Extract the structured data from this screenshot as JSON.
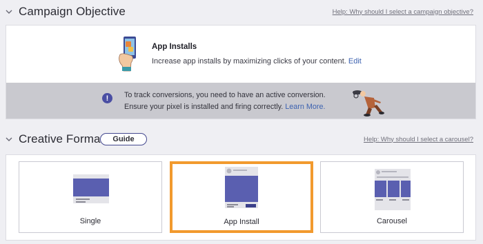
{
  "campaign_objective": {
    "title": "Campaign Objective",
    "help_link": "Help: Why should I select a campaign objective?",
    "objective": {
      "name": "App Installs",
      "description": "Increase app installs by maximizing clicks of your content.",
      "edit_label": "Edit",
      "icon": "phone-in-hand-icon"
    },
    "notice": {
      "line1": "To track conversions, you need to have an active conversion.",
      "line2": "Ensure your pixel is installed and firing correctly.",
      "learn_more": "Learn More.",
      "icon": "exclamation-icon"
    }
  },
  "creative_format": {
    "title": "Creative Format",
    "guide_label": "Guide",
    "help_link": "Help: Why should I select a carousel?",
    "options": [
      {
        "label": "Single",
        "selected": false
      },
      {
        "label": "App Install",
        "selected": true
      },
      {
        "label": "Carousel",
        "selected": false
      }
    ]
  },
  "colors": {
    "accent_blue": "#4a4ea3",
    "selected_orange": "#f29a2e",
    "link_blue": "#3d62b0"
  }
}
